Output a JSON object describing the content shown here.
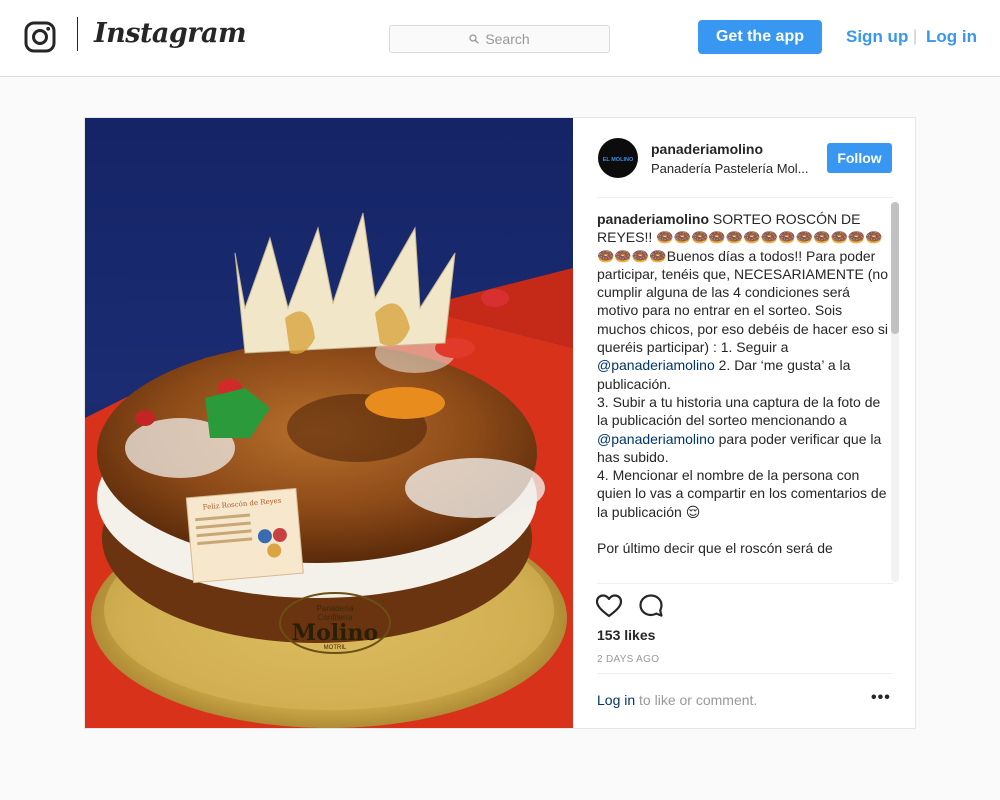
{
  "header": {
    "brand": "Instagram",
    "search_placeholder": "Search",
    "get_app_label": "Get the app",
    "signup_label": "Sign up",
    "separator": "|",
    "login_label": "Log in"
  },
  "post": {
    "username": "panaderiamolino",
    "subtitle": "Panadería Pastelería Mol...",
    "follow_label": "Follow",
    "caption": {
      "username": "panaderiamolino",
      "part1": " SORTEO ROSCÓN DE REYES!! 🍩🍩🍩🍩🍩🍩🍩🍩🍩🍩🍩🍩🍩🍩🍩🍩🍩Buenos días a todos!! Para poder participar, tenéis que, NECESARIAMENTE (no cumplir alguna de las 4 condiciones será motivo para no entrar en el sorteo. Sois muchos chicos, por eso debéis de hacer eso si queréis participar) : 1. Seguir a ",
      "mention1": "@panaderiamolino",
      "part2": " 2. Dar ‘me gusta’ a la publicación.\n3. Subir a tu historia una captura de la foto de la publicación del sorteo mencionando a ",
      "mention2": "@panaderiamolino",
      "part3": " para poder verificar que la has subido.\n4. Mencionar el nombre de la persona con quien lo vas a compartir en los comentarios de la publicación 😌\n\nPor último decir que el roscón será de"
    },
    "likes": "153 likes",
    "time": "2 DAYS AGO",
    "login_link": "Log in",
    "login_suffix": " to like or comment.",
    "more": "•••",
    "photo": {
      "tag_title": "Feliz Roscón de Reyes",
      "plate_top": "Panadería",
      "plate_mid": "Confitería",
      "plate_brand": "Molino",
      "plate_bottom": "MOTRIL"
    },
    "avatar_text": "EL MOLINO"
  },
  "colors": {
    "accent": "#3897f0",
    "mention": "#003569",
    "muted": "#999999"
  }
}
